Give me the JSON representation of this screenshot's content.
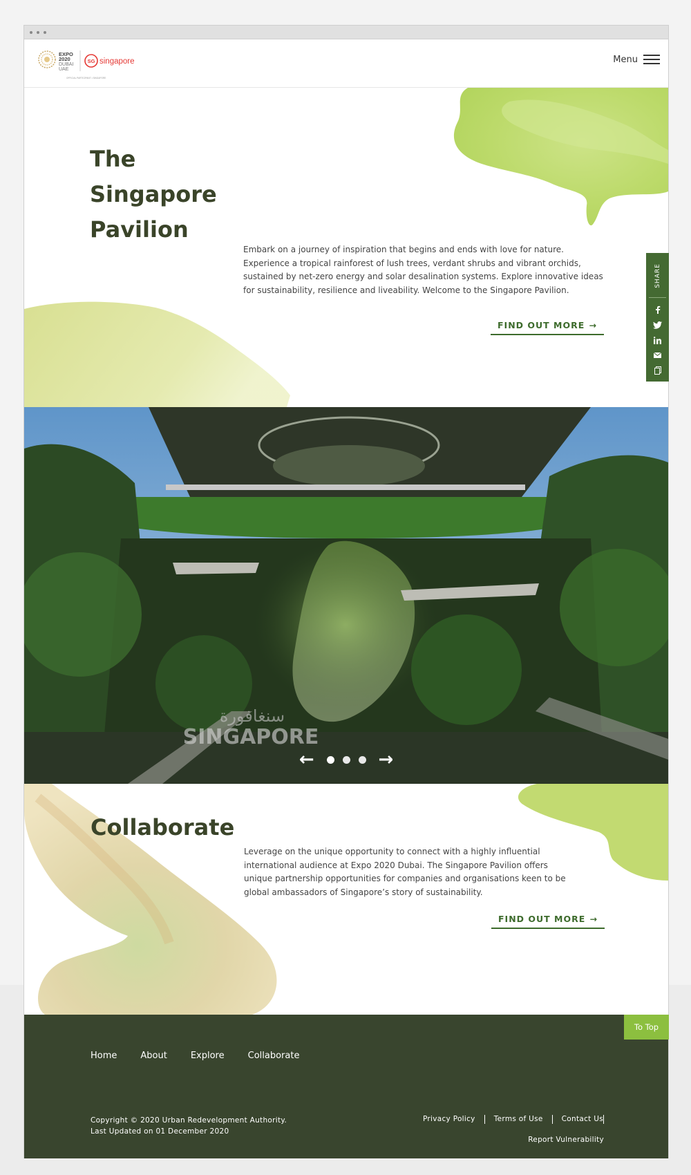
{
  "header": {
    "logo_expo": "EXPO 2020 DUBAI UAE",
    "logo_brand": "singapore",
    "logo_badge": "SG",
    "logo_caption": "OFFICIAL PARTICIPANT • SINGAPORE",
    "menu_label": "Menu"
  },
  "intro": {
    "title_line1": "The",
    "title_line2": "Singapore",
    "title_line3": "Pavilion",
    "description": "Embark on a journey of inspiration that begins and ends with love for nature. Experience a tropical rainforest of lush trees, verdant shrubs and vibrant orchids, sustained by net-zero energy and solar desalination systems. Explore innovative ideas for sustainability, resilience and liveability. Welcome to the Singapore Pavilion.",
    "cta_label": "FIND OUT MORE",
    "cta_icon": "arrow-right-icon"
  },
  "share": {
    "label": "SHARE",
    "items": [
      "facebook-icon",
      "twitter-icon",
      "linkedin-icon",
      "email-icon",
      "copy-icon"
    ]
  },
  "carousel": {
    "watermark_arabic": "سنغافورة",
    "watermark_text": "SINGAPORE",
    "slide_count": 3,
    "active_slide": 1
  },
  "collaborate": {
    "title": "Collaborate",
    "description": "Leverage on the unique opportunity to connect with a highly influential international audience at Expo 2020 Dubai. The Singapore Pavilion offers unique partnership opportunities for companies and organisations keen to be global ambassadors of Singapore’s story of sustainability.",
    "cta_label": "FIND OUT MORE"
  },
  "footer": {
    "to_top": "To Top",
    "nav": [
      "Home",
      "About",
      "Explore",
      "Collaborate"
    ],
    "copyright": "Copyright © 2020 Urban Redevelopment Authority.",
    "last_updated": "Last Updated on 01 December 2020",
    "links": [
      "Privacy Policy",
      "Terms of Use",
      "Contact Us"
    ],
    "report": "Report Vulnerability"
  },
  "colors": {
    "accent_green": "#446a32",
    "footer_bg": "#39452e",
    "to_top_bg": "#8cbf3f",
    "title_color": "#3a4429"
  }
}
